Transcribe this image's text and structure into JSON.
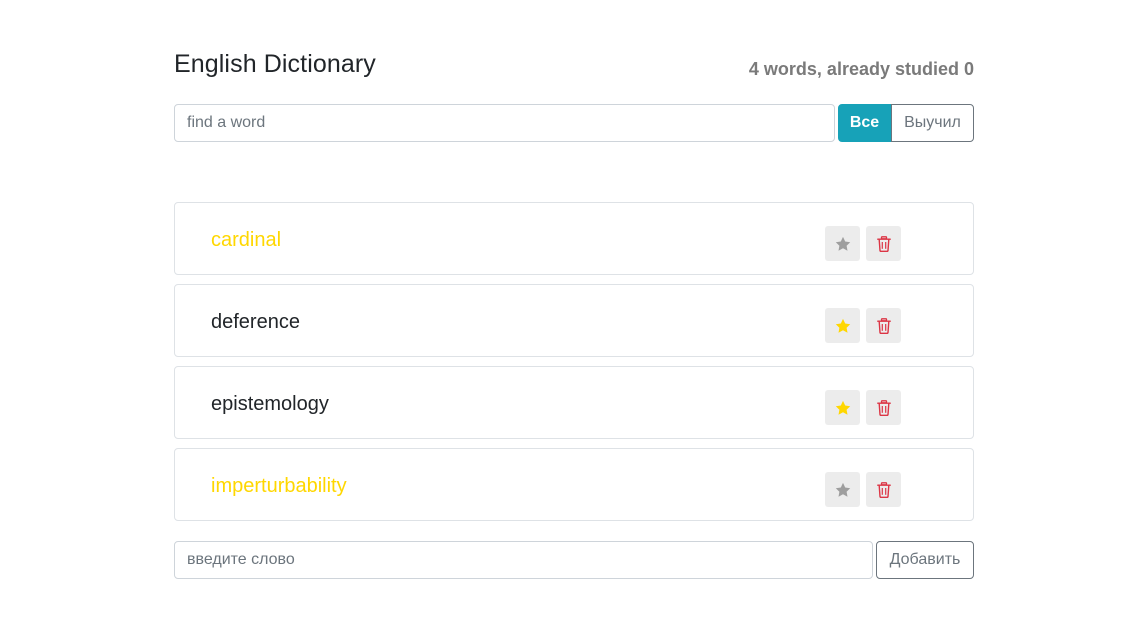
{
  "header": {
    "title": "English Dictionary",
    "counter": "4 words, already studied 0"
  },
  "search": {
    "placeholder": "find a word",
    "value": ""
  },
  "filters": [
    {
      "label": "Все",
      "active": true
    },
    {
      "label": "Выучил",
      "active": false
    }
  ],
  "words": [
    {
      "text": "cardinal",
      "important": true,
      "starred": false
    },
    {
      "text": "deference",
      "important": false,
      "starred": true
    },
    {
      "text": "epistemology",
      "important": false,
      "starred": true
    },
    {
      "text": "imperturbability",
      "important": true,
      "starred": false
    }
  ],
  "icons": {
    "star": "star-icon",
    "trash": "trash-icon"
  },
  "add_form": {
    "placeholder": "введите слово",
    "value": "",
    "button_label": "Добавить"
  },
  "colors": {
    "accent": "#17a2b8",
    "important_word": "#ffd700",
    "star_active": "#ffd700",
    "star_inactive": "#9e9e9e",
    "delete": "#dc3545",
    "icon_button_bg": "#ececec"
  }
}
